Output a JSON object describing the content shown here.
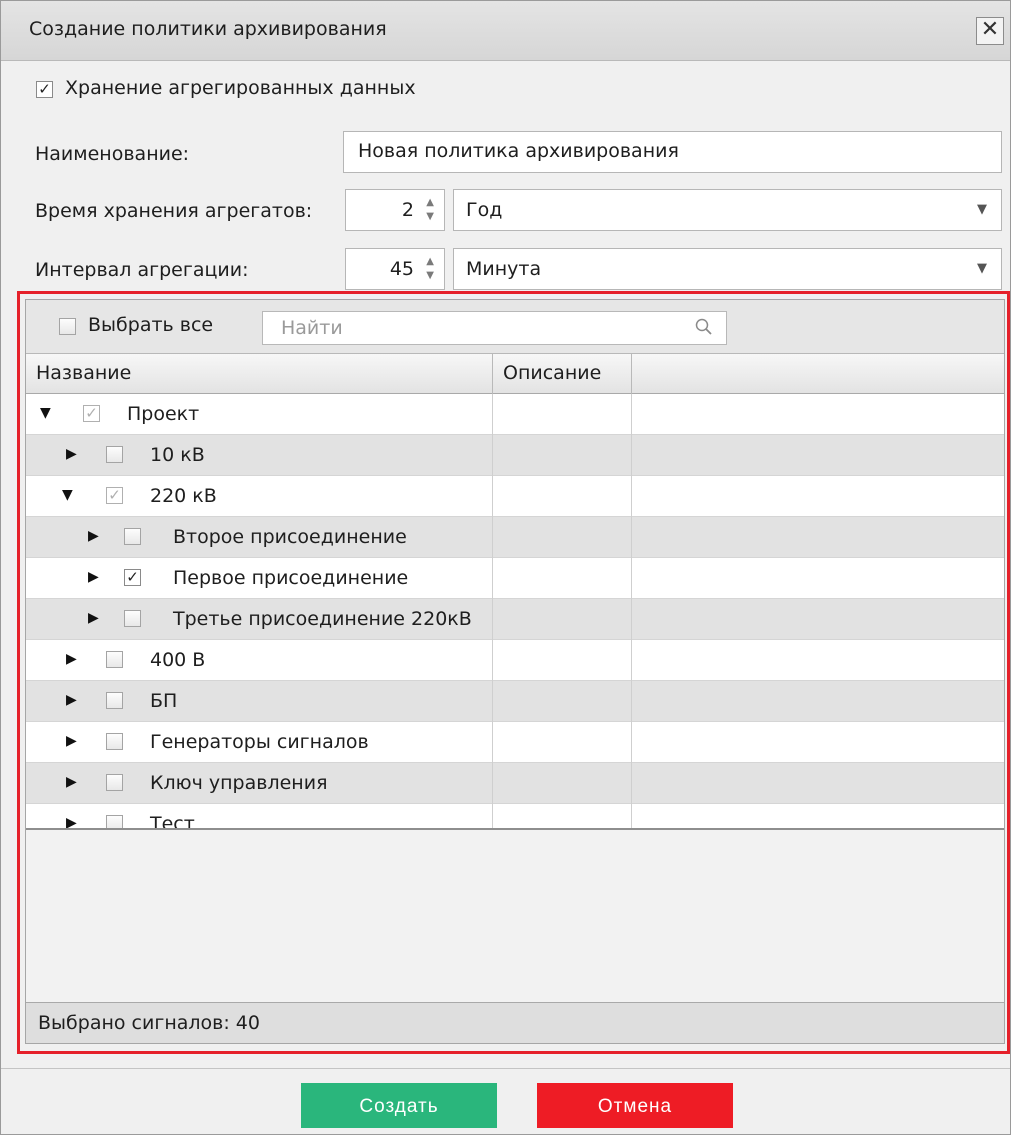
{
  "dialog": {
    "title": "Создание политики архивирования",
    "close_symbol": "✕"
  },
  "store_aggregated": {
    "label": "Хранение агрегированных данных",
    "checked": true
  },
  "name_field": {
    "label": "Наименование:",
    "value": "Новая политика архивирования"
  },
  "retention": {
    "label": "Время хранения агрегатов:",
    "value": "2",
    "unit": "Год"
  },
  "interval": {
    "label": "Интервал агрегации:",
    "value": "45",
    "unit": "Минута"
  },
  "signals_panel": {
    "select_all_label": "Выбрать все",
    "search_placeholder": "Найти",
    "columns": [
      "Название",
      "Описание"
    ],
    "rows": [
      {
        "label": "Проект",
        "expanded": true,
        "checked": "partial",
        "level": 0
      },
      {
        "label": "10 кВ",
        "expanded": false,
        "checked": "none",
        "level": 1
      },
      {
        "label": "220 кВ",
        "expanded": true,
        "checked": "partial",
        "level": 1
      },
      {
        "label": "Второе присоединение",
        "expanded": false,
        "checked": "none",
        "level": 2
      },
      {
        "label": "Первое присоединение",
        "expanded": false,
        "checked": "full",
        "level": 2
      },
      {
        "label": "Третье присоединение 220кВ",
        "expanded": false,
        "checked": "none",
        "level": 2
      },
      {
        "label": "400 В",
        "expanded": false,
        "checked": "none",
        "level": 1
      },
      {
        "label": "БП",
        "expanded": false,
        "checked": "none",
        "level": 1
      },
      {
        "label": "Генераторы сигналов",
        "expanded": false,
        "checked": "none",
        "level": 1
      },
      {
        "label": "Ключ управления",
        "expanded": false,
        "checked": "none",
        "level": 1
      },
      {
        "label": "Тест",
        "expanded": false,
        "checked": "none",
        "level": 1
      }
    ],
    "status": "Выбрано сигналов: 40"
  },
  "buttons": {
    "create": "Создать",
    "cancel": "Отмена"
  },
  "colors": {
    "create": "#2ab67c",
    "cancel": "#ee1c25",
    "highlight": "#e5202a"
  }
}
